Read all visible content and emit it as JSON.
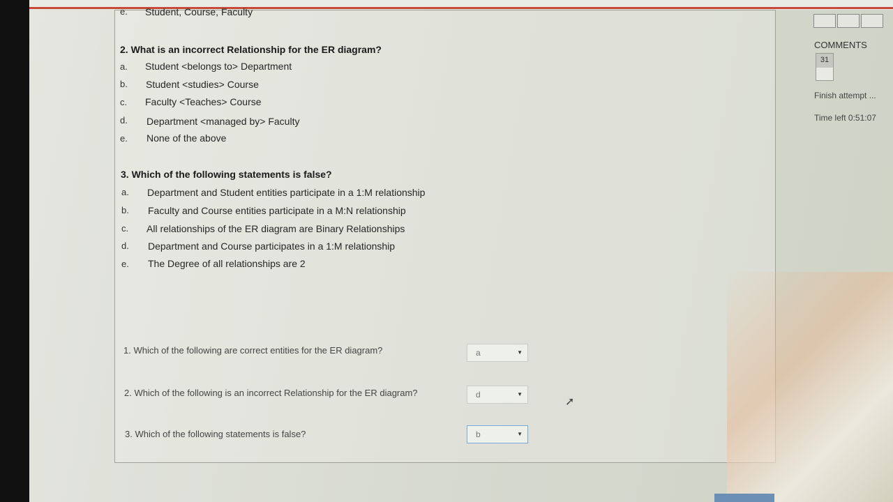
{
  "top_item": {
    "letter": "e.",
    "text": "Student, Course, Faculty"
  },
  "questions": [
    {
      "title": "2. What is an incorrect Relationship for the ER diagram?",
      "options": [
        {
          "letter": "a.",
          "text": "Student <belongs to> Department"
        },
        {
          "letter": "b.",
          "text": "Student <studies> Course"
        },
        {
          "letter": "c.",
          "text": "Faculty <Teaches> Course"
        },
        {
          "letter": "d.",
          "text": "Department <managed by> Faculty"
        },
        {
          "letter": "e.",
          "text": "None of the above"
        }
      ]
    },
    {
      "title": "3. Which of the following statements is false?",
      "options": [
        {
          "letter": "a.",
          "text": "Department and Student entities participate in a 1:M relationship"
        },
        {
          "letter": "b.",
          "text": "Faculty and Course entities participate in a M:N relationship"
        },
        {
          "letter": "c.",
          "text": "All relationships of the ER diagram are Binary Relationships"
        },
        {
          "letter": "d.",
          "text": "Department and Course participates in a 1:M relationship"
        },
        {
          "letter": "e.",
          "text": "The Degree of all relationships are 2"
        }
      ]
    }
  ],
  "matching": [
    {
      "question": "1. Which of the following are correct entities for the ER diagram?",
      "answer": "a"
    },
    {
      "question": "2. Which of the following is an incorrect Relationship for the ER diagram?",
      "answer": "d"
    },
    {
      "question": "3. Which of the following statements is false?",
      "answer": "b"
    }
  ],
  "sidebar": {
    "title": "COMMENTS",
    "number": "31",
    "finish": "Finish attempt ...",
    "time_left": "Time left 0:51:07"
  },
  "colors": {
    "accent_line": "#c84a3a",
    "active_border": "#7aa8d8"
  }
}
